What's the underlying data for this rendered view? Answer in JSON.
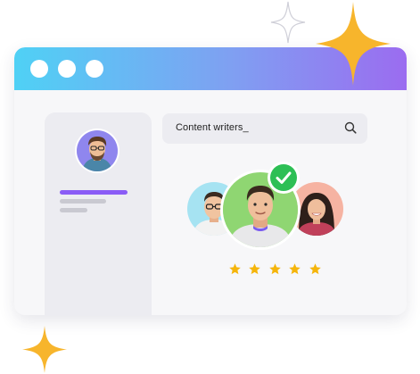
{
  "colors": {
    "titlebar_gradient_start": "#4fd1f5",
    "titlebar_gradient_end": "#9b6cf0",
    "accent_bar": "#8a5cf6",
    "placeholder_bar": "#c9c9d1",
    "sparkle_gold": "#f7b52c",
    "star_gold": "#f5b50b",
    "check_green": "#2dbf55"
  },
  "window": {
    "controls": [
      "dot",
      "dot",
      "dot"
    ]
  },
  "search": {
    "text": "Content writers_",
    "icon": "search-icon"
  },
  "sidebar": {
    "avatar_icon": "person-avatar"
  },
  "candidates": [
    {
      "icon": "person-with-glasses-avatar"
    },
    {
      "icon": "person-selected-avatar",
      "selected": true
    },
    {
      "icon": "person-smiling-avatar"
    }
  ],
  "rating": {
    "stars": 5,
    "max": 5
  }
}
